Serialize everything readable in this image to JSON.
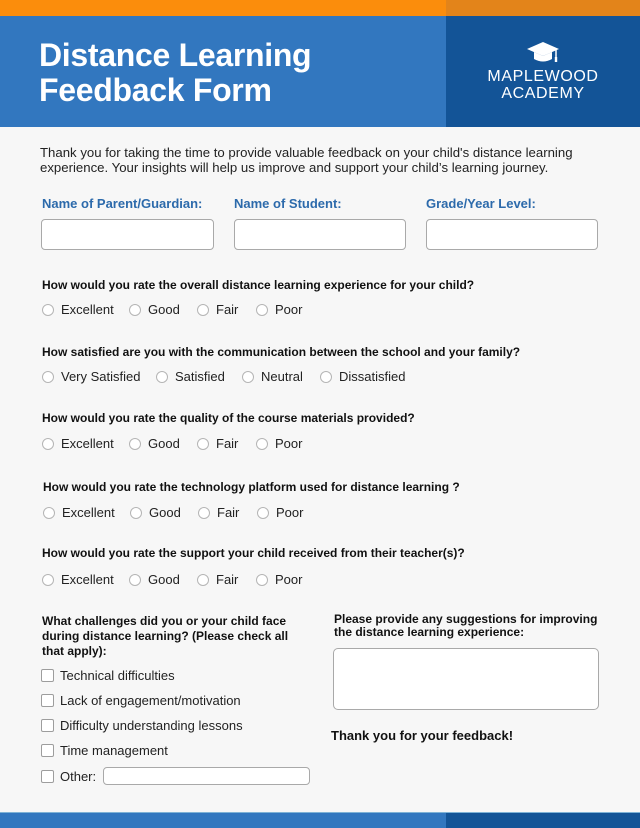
{
  "header": {
    "title_line1": "Distance Learning",
    "title_line2": "Feedback Form",
    "logo_icon": "graduation-cap-icon",
    "logo_line1": "MAPLEWOOD",
    "logo_line2": "ACADEMY"
  },
  "colors": {
    "accent_orange": "#fb8d0c",
    "header_blue": "#3277bf",
    "header_dark_blue": "#135497",
    "label_blue": "#2c6aab",
    "background": "#f7f7f7"
  },
  "intro": "Thank you for taking the time to provide valuable feedback on your child's distance learning experience. Your insights will help us improve and support your child’s learning journey.",
  "fields": [
    {
      "label": "Name of Parent/Guardian:",
      "value": ""
    },
    {
      "label": "Name of Student:",
      "value": ""
    },
    {
      "label": "Grade/Year Level:",
      "value": ""
    }
  ],
  "questions": [
    {
      "text": "How would you rate the overall distance learning experience for your child?",
      "options": [
        "Excellent",
        "Good",
        "Fair",
        "Poor"
      ]
    },
    {
      "text": "How satisfied are you with the communication between the school and your family?",
      "options": [
        "Very Satisfied",
        "Satisfied",
        "Neutral",
        "Dissatisfied"
      ]
    },
    {
      "text": "How would you rate the quality of the course materials provided?",
      "options": [
        "Excellent",
        "Good",
        "Fair",
        "Poor"
      ]
    },
    {
      "text": "How would you rate the technology platform used for distance learning ?",
      "options": [
        "Excellent",
        "Good",
        "Fair",
        "Poor"
      ]
    },
    {
      "text": "How would you rate the support your child received from their teacher(s)?",
      "options": [
        "Excellent",
        "Good",
        "Fair",
        "Poor"
      ]
    }
  ],
  "challenges": {
    "question": "What challenges did you or your child face during distance learning? (Please check all that apply):",
    "items": [
      "Technical difficulties",
      "Lack of engagement/motivation",
      "Difficulty understanding lessons",
      "Time management",
      "Other:"
    ],
    "other_value": ""
  },
  "suggestions": {
    "question": "Please provide any suggestions for improving the distance learning experience:",
    "value": ""
  },
  "closing": "Thank you for your feedback!"
}
